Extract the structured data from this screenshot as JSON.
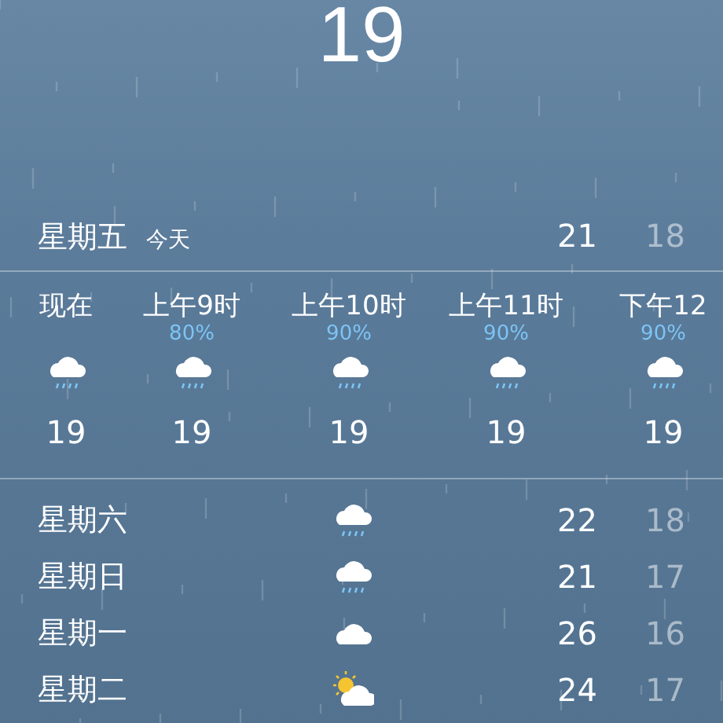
{
  "current": {
    "temperature": "19"
  },
  "today": {
    "day": "星期五",
    "label": "今天",
    "high": "21",
    "low": "18"
  },
  "hourly": [
    {
      "time": "现在",
      "kind": "rain",
      "temp": "19"
    },
    {
      "time": "上午9时",
      "chance": "80%",
      "kind": "rain",
      "temp": "19"
    },
    {
      "time": "上午10时",
      "chance": "90%",
      "kind": "rain",
      "temp": "19"
    },
    {
      "time": "上午11时",
      "chance": "90%",
      "kind": "rain",
      "temp": "19"
    },
    {
      "time": "下午12",
      "chance": "90%",
      "kind": "rain",
      "temp": "19"
    }
  ],
  "daily": [
    {
      "day": "星期六",
      "kind": "rain",
      "high": "22",
      "low": "18"
    },
    {
      "day": "星期日",
      "kind": "rain",
      "high": "21",
      "low": "17"
    },
    {
      "day": "星期一",
      "kind": "cloud",
      "high": "26",
      "low": "16"
    },
    {
      "day": "星期二",
      "kind": "partly-sunny",
      "high": "24",
      "low": "17"
    }
  ]
}
